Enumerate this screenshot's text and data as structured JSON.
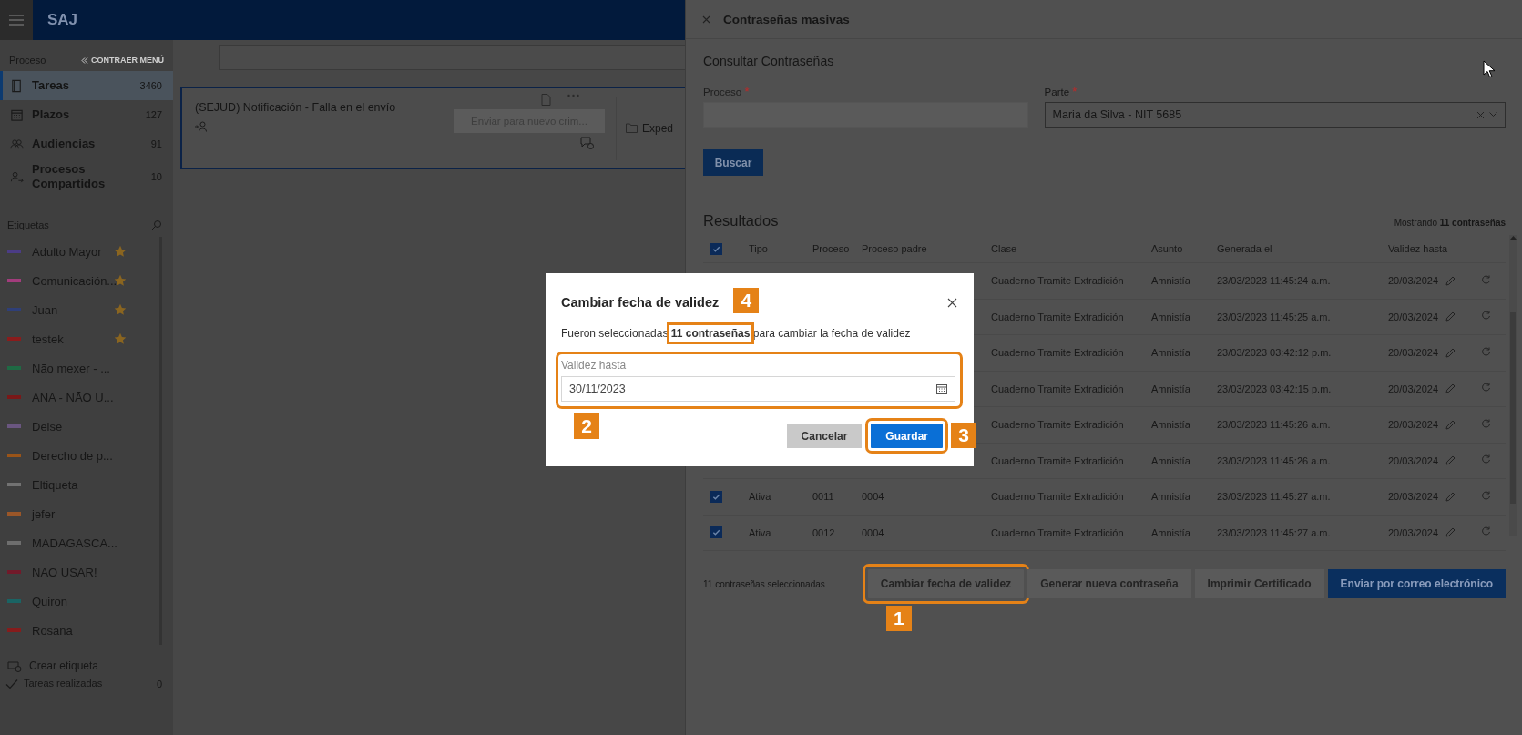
{
  "app_bar": {
    "title": "SAJ"
  },
  "sidebar": {
    "section": "Proceso",
    "collapse": "CONTRAER MENÚ",
    "items": [
      {
        "kind": "tasks",
        "label": "Tareas",
        "count": "3460",
        "selected": true
      },
      {
        "kind": "deadlines",
        "label": "Plazos",
        "count": "127",
        "selected": false
      },
      {
        "kind": "hearings",
        "label": "Audiencias",
        "count": "91",
        "selected": false
      },
      {
        "kind": "shared",
        "label": "Procesos Compartidos",
        "count": "10",
        "selected": false
      }
    ],
    "tags_title": "Etiquetas",
    "tags": [
      {
        "label": "Adulto Mayor",
        "color": "#4b3c86",
        "starred": true
      },
      {
        "label": "Comunicación...",
        "color": "#a23c7c",
        "starred": true
      },
      {
        "label": "Juan",
        "color": "#2f3f78",
        "starred": true
      },
      {
        "label": "testek",
        "color": "#8a1c1c",
        "starred": true
      },
      {
        "label": "Não mexer - ...",
        "color": "#1f6a44",
        "starred": false
      },
      {
        "label": "ANA - NÃO U...",
        "color": "#7a1818",
        "starred": false
      },
      {
        "label": "Deise",
        "color": "#6a5680",
        "starred": false
      },
      {
        "label": "Derecho de p...",
        "color": "#9a5418",
        "starred": false
      },
      {
        "label": "Eltiqueta",
        "color": "#727272",
        "starred": false
      },
      {
        "label": "jefer",
        "color": "#9a5628",
        "starred": false
      },
      {
        "label": "MADAGASCA...",
        "color": "#6e6e6e",
        "starred": false
      },
      {
        "label": "NÃO USAR!",
        "color": "#721a2a",
        "starred": false
      },
      {
        "label": "Quiron",
        "color": "#1a6464",
        "starred": false
      },
      {
        "label": "Rosana",
        "color": "#861c1c",
        "starred": false
      }
    ],
    "create_tag": "Crear etiqueta",
    "done": {
      "label": "Tareas realizadas",
      "count": "0"
    }
  },
  "task_card": {
    "title": "(SEJUD) Notificación - Falla en el envío",
    "action": "Enviar para nuevo crim...",
    "action_disabled": true,
    "link": "Exped"
  },
  "panel": {
    "title": "Contraseñas masivas",
    "section": "Consultar Contraseñas",
    "fields": [
      {
        "label": "Proceso",
        "required_mark": "*",
        "disabled": true
      },
      {
        "label": "Parte",
        "required_mark": "*",
        "disabled": false,
        "value": "Maria da Silva - NIT 5685"
      }
    ],
    "search_button": "Buscar",
    "results_title": "Resultados",
    "results_count": "Mostrando **11 contraseñas**",
    "table": {
      "select_all": true,
      "columns": [
        "Tipo",
        "Proceso",
        "Proceso padre",
        "Clase",
        "Asunto",
        "Generada el",
        "Validez hasta"
      ],
      "rows": [
        {
          "clase": "Cuaderno Tramite Extradición",
          "asunto": "Amnistía",
          "generada": "23/03/2023 11:45:24 a.m.",
          "validez": "20/03/2024"
        },
        {
          "clase": "Cuaderno Tramite Extradición",
          "asunto": "Amnistía",
          "generada": "23/03/2023 11:45:25 a.m.",
          "validez": "20/03/2024"
        },
        {
          "clase": "Cuaderno Tramite Extradición",
          "asunto": "Amnistía",
          "generada": "23/03/2023 03:42:12 p.m.",
          "validez": "20/03/2024"
        },
        {
          "clase": "Cuaderno Tramite Extradición",
          "asunto": "Amnistía",
          "generada": "23/03/2023 03:42:15 p.m.",
          "validez": "20/03/2024"
        },
        {
          "clase": "Cuaderno Tramite Extradición",
          "asunto": "Amnistía",
          "generada": "23/03/2023 11:45:26 a.m.",
          "validez": "20/03/2024"
        },
        {
          "clase": "Cuaderno Tramite Extradición",
          "asunto": "Amnistía",
          "generada": "23/03/2023 11:45:26 a.m.",
          "validez": "20/03/2024"
        },
        {
          "checked": true,
          "tipo": "Ativa",
          "proceso": "0011",
          "proceso_padre": "0004",
          "clase": "Cuaderno Tramite Extradición",
          "asunto": "Amnistía",
          "generada": "23/03/2023 11:45:27 a.m.",
          "validez": "20/03/2024"
        },
        {
          "checked": true,
          "tipo": "Ativa",
          "proceso": "0012",
          "proceso_padre": "0004",
          "clase": "Cuaderno Tramite Extradición",
          "asunto": "Amnistía",
          "generada": "23/03/2023 11:45:27 a.m.",
          "validez": "20/03/2024"
        }
      ]
    },
    "selection_note": "11 contraseñas seleccionadas",
    "actions": [
      {
        "kind": "secondary",
        "label": "Cambiar fecha de validez",
        "callout": "1"
      },
      {
        "kind": "secondary",
        "label": "Generar nueva contraseña"
      },
      {
        "kind": "secondary",
        "label": "Imprimir Certificado"
      },
      {
        "kind": "primary",
        "label": "Enviar por correo electrónico"
      }
    ]
  },
  "dialog": {
    "title": "Cambiar fecha de validez",
    "message": "Fueron seleccionadas **11 contraseñas** para cambiar la fecha de validez",
    "message_callout": "4",
    "field": {
      "label": "Validez hasta",
      "value": "30/11/2023",
      "callout": "2"
    },
    "buttons": [
      {
        "kind": "secondary",
        "label": "Cancelar"
      },
      {
        "kind": "primary",
        "label": "Guardar",
        "callout": "3"
      }
    ]
  }
}
